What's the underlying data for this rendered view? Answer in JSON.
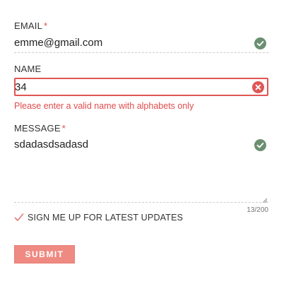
{
  "form": {
    "email": {
      "label": "EMAIL",
      "required_marker": "*",
      "value": "emme@gmail.com",
      "status": "valid"
    },
    "name": {
      "label": "NAME",
      "value": "34",
      "status": "invalid",
      "error": "Please enter a valid name with alphabets only"
    },
    "message": {
      "label": "MESSAGE",
      "required_marker": "*",
      "value": "sdadasdsadasd",
      "status": "valid",
      "counter": "13/200"
    },
    "signup_checkbox": {
      "label": "SIGN ME UP FOR LATEST UPDATES",
      "checked": true
    },
    "submit_label": "SUBMIT"
  },
  "colors": {
    "valid": "#6b8f71",
    "invalid": "#e05555",
    "accent": "#ef8a82",
    "required": "#e24b4b"
  },
  "icons": {
    "valid": "check-circle-icon",
    "invalid": "x-circle-icon",
    "checkbox": "checkmark-icon",
    "resize": "resize-handle-icon"
  }
}
